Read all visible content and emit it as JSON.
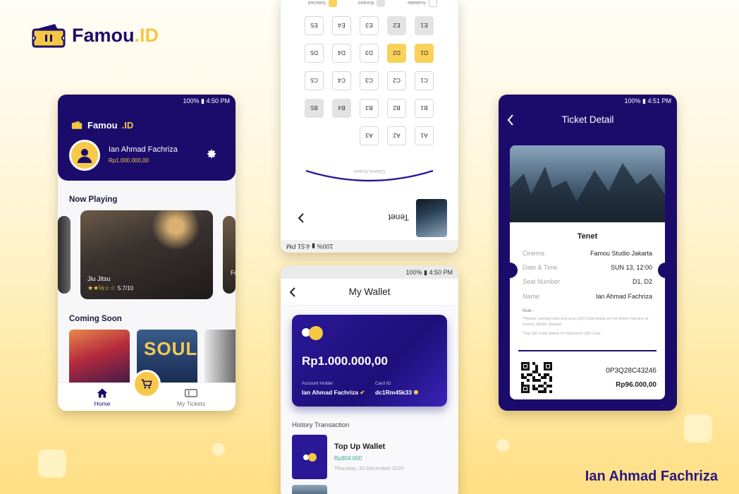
{
  "brand": {
    "name_main": "Famou",
    "name_accent": ".ID"
  },
  "author": "Ian Ahmad Fachriza",
  "home": {
    "status": "100% ▮ 4:50 PM",
    "logo_main": "Famou",
    "logo_accent": ".ID",
    "user_name": "Ian Ahmad Fachriza",
    "balance": "Rp1.000.000,00",
    "now_playing_title": "Now Playing",
    "movie_title": "Jiu Jitsu",
    "movie_rating": "5.7/10",
    "coming_soon_title": "Coming Soon",
    "nav_home": "Home",
    "nav_tickets": "My Tickets",
    "side_movie_partial": "Fa"
  },
  "seats": {
    "status": "100% ▮ 4:51 PM",
    "legend_selected": "Selected",
    "legend_booked": "Booked",
    "legend_available": "Available",
    "screen_label": "Cinema Screen",
    "movie_title": "Tenet",
    "rows": [
      [
        "E1",
        "E2",
        "E3",
        "E4",
        "E5"
      ],
      [
        "D1",
        "D2",
        "D3",
        "D4",
        "D5"
      ],
      [
        "C1",
        "C2",
        "C3",
        "C4",
        "C5"
      ],
      [
        "B1",
        "B2",
        "B3",
        "B4",
        "B5"
      ],
      [
        "A1",
        "A2",
        "A3"
      ]
    ]
  },
  "wallet": {
    "status": "100% ▮ 4:50 PM",
    "title": "My Wallet",
    "balance": "Rp1.000.000,00",
    "holder_label": "Account Holder",
    "holder_value": "Ian Ahmad Fachriza",
    "card_label": "Card ID",
    "card_value": "dc1Rm45k33",
    "history_title": "History Transaction",
    "tx_title": "Top Up Wallet",
    "tx_amount": "Rp804.000",
    "tx_date": "Thursday, 10 December 2020"
  },
  "ticket": {
    "status": "100% ▮ 4:51 PM",
    "title": "Ticket Detail",
    "movie": "Tenet",
    "cinema_label": "Cinema",
    "cinema_value": "Famou Studio Jakarta",
    "date_label": "Date & Time",
    "date_value": "SUN 13, 12:00",
    "seat_label": "Seat Number",
    "seat_value": "D1, D2",
    "name_label": "Name",
    "name_value": "Ian Ahmad Fachriza",
    "note_title": "Note :",
    "note_1": "*Please coming early and scan QR Code below on the ticket machine at Famou Studio Jakarta",
    "note_2": "*Tap QR Code below for fullscreen QR Code",
    "code": "0P3Q28C43246",
    "price": "Rp96.000,00"
  },
  "colors": {
    "primary": "#1b0c6b",
    "accent": "#f5c843",
    "wallet_card": "#2a1899"
  }
}
